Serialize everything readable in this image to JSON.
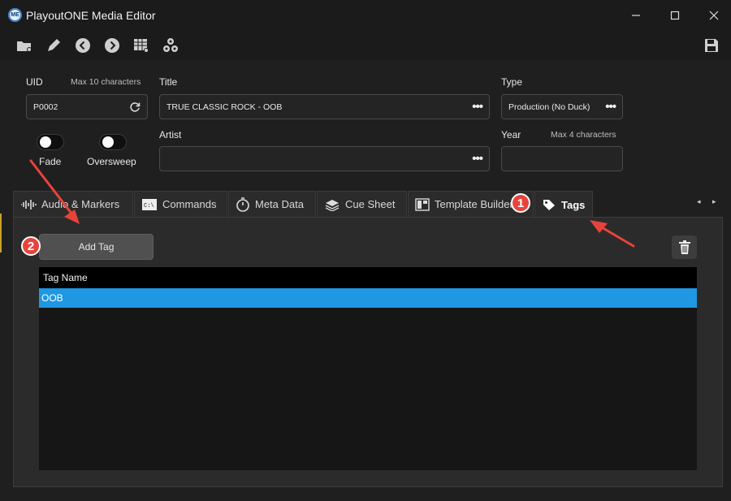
{
  "window": {
    "title": "PlayoutONE Media Editor",
    "logo_text": "ME",
    "minimize_glyph": "—",
    "maximize_glyph": "☐",
    "close_glyph": "✕"
  },
  "toolbar": {
    "icons": [
      "folder-open-icon",
      "pencil-icon",
      "back-arrow-icon",
      "forward-arrow-icon",
      "grid-settings-icon",
      "cogs-icon",
      "save-icon"
    ]
  },
  "form": {
    "uid": {
      "label": "UID",
      "hint": "Max 10 characters",
      "value": "P0002"
    },
    "title": {
      "label": "Title",
      "value": "TRUE CLASSIC ROCK - OOB"
    },
    "type": {
      "label": "Type",
      "value": "Production (No Duck)"
    },
    "artist": {
      "label": "Artist",
      "value": ""
    },
    "year": {
      "label": "Year",
      "hint": "Max 4 characters",
      "value": ""
    },
    "fade": {
      "label": "Fade",
      "on": false
    },
    "oversweep": {
      "label": "Oversweep",
      "on": false
    },
    "dots": "•••"
  },
  "tabs": [
    {
      "label": "Audio & Markers",
      "icon": "waveform-icon"
    },
    {
      "label": "Commands",
      "icon": "command-prompt-icon"
    },
    {
      "label": "Meta Data",
      "icon": "stopwatch-icon"
    },
    {
      "label": "Cue Sheet",
      "icon": "layers-icon"
    },
    {
      "label": "Template Builder",
      "icon": "template-icon"
    },
    {
      "label": "Tags",
      "icon": "tag-icon",
      "active": true
    }
  ],
  "tab_scroll": {
    "left": "◂",
    "right": "▸"
  },
  "tags_panel": {
    "add_button": "Add Tag",
    "column_header": "Tag Name",
    "rows": [
      "OOB"
    ]
  },
  "annotations": {
    "badge_1": "1",
    "badge_2": "2",
    "color": "#e8433b"
  },
  "colors": {
    "selection": "#1f97e3",
    "background": "#1f1f1f",
    "panel": "#2b2b2b"
  }
}
